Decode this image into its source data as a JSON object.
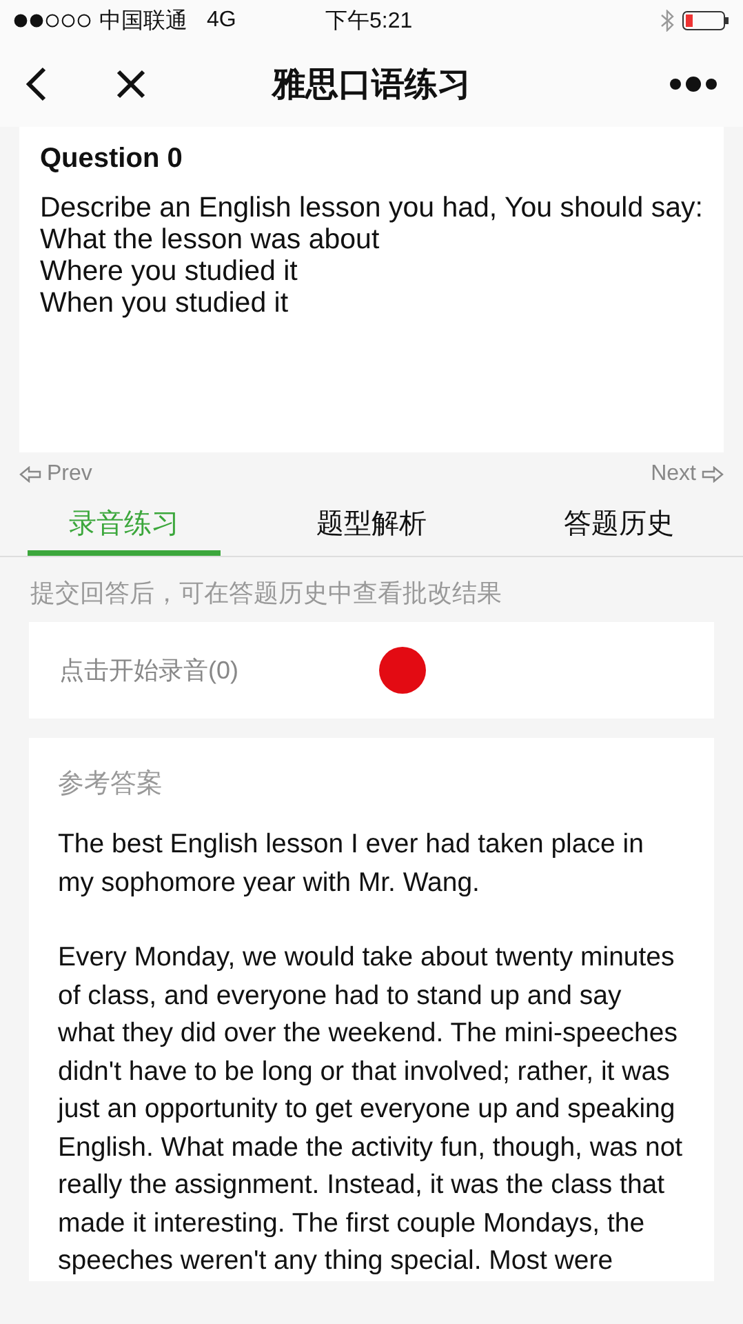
{
  "status_bar": {
    "carrier": "中国联通",
    "network": "4G",
    "time": "下午5:21"
  },
  "nav_bar": {
    "title": "雅思口语练习"
  },
  "question": {
    "title": "Question 0",
    "lines": [
      "Describe an English lesson you had, You should say:",
      "What the lesson was about",
      "Where you studied it",
      "When you studied it"
    ]
  },
  "pager": {
    "prev": "Prev",
    "next": "Next"
  },
  "tabs": [
    {
      "label": "录音练习",
      "selected": true
    },
    {
      "label": "题型解析",
      "selected": false
    },
    {
      "label": "答题历史",
      "selected": false
    }
  ],
  "hint": "提交回答后，可在答题历史中查看批改结果",
  "recorder": {
    "label": "点击开始录音(0)"
  },
  "answer": {
    "title": "参考答案",
    "paragraphs": [
      "The best English lesson I ever had taken place in my sophomore year with Mr. Wang.",
      "Every Monday, we would take about twenty minutes of class, and everyone had to stand up and say what they did over the weekend. The mini-speeches didn't have to be long or that involved; rather, it was just an opportunity to get everyone up and speaking English. What made the activity fun, though, was not really the assignment. Instead, it was the class that made it interesting. The first couple Mondays, the speeches weren't any thing special. Most were"
    ]
  }
}
